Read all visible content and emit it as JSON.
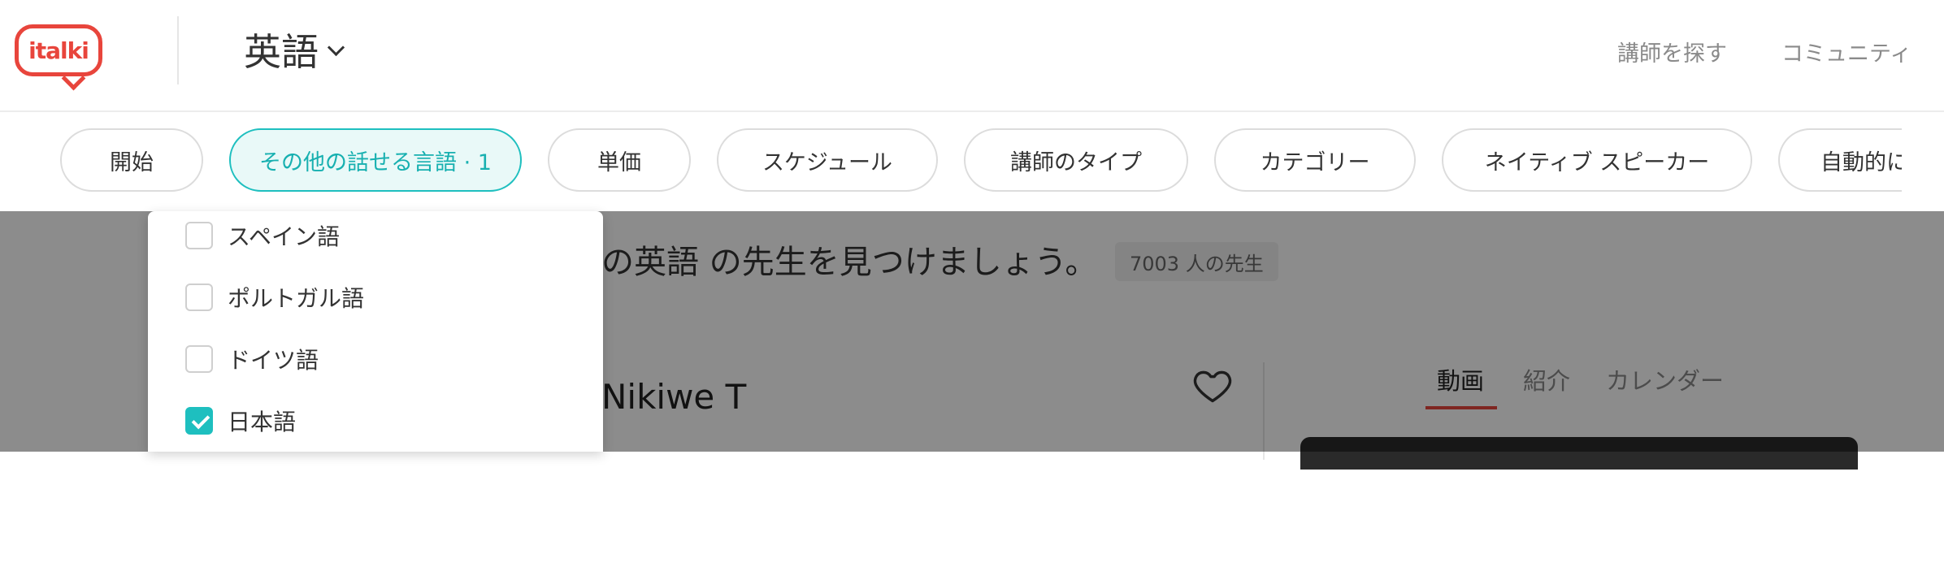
{
  "header": {
    "logo_text": "italki",
    "language": "英語",
    "nav": [
      "講師を探す",
      "コミュニティ"
    ]
  },
  "filters": [
    {
      "label": "開始",
      "active": false
    },
    {
      "label": "その他の話せる言語 · 1",
      "active": true
    },
    {
      "label": "単価",
      "active": false
    },
    {
      "label": "スケジュール",
      "active": false
    },
    {
      "label": "講師のタイプ",
      "active": false
    },
    {
      "label": "カテゴリー",
      "active": false
    },
    {
      "label": "ネイティブ スピーカー",
      "active": false
    },
    {
      "label": "自動的に",
      "active": false
    }
  ],
  "dropdown": {
    "options": [
      {
        "label": "スペイン語",
        "checked": false
      },
      {
        "label": "ポルトガル語",
        "checked": false
      },
      {
        "label": "ドイツ語",
        "checked": false
      },
      {
        "label": "日本語",
        "checked": true
      }
    ]
  },
  "results": {
    "heading": "の英語 の先生を見つけましょう。",
    "count": "7003 人の先生"
  },
  "teacher": {
    "name": "Nikiwe T",
    "tabs": [
      "動画",
      "紹介",
      "カレンダー"
    ],
    "active_tab": "動画"
  },
  "colors": {
    "brand_red": "#e8453c",
    "accent_teal": "#1ebfbf"
  }
}
